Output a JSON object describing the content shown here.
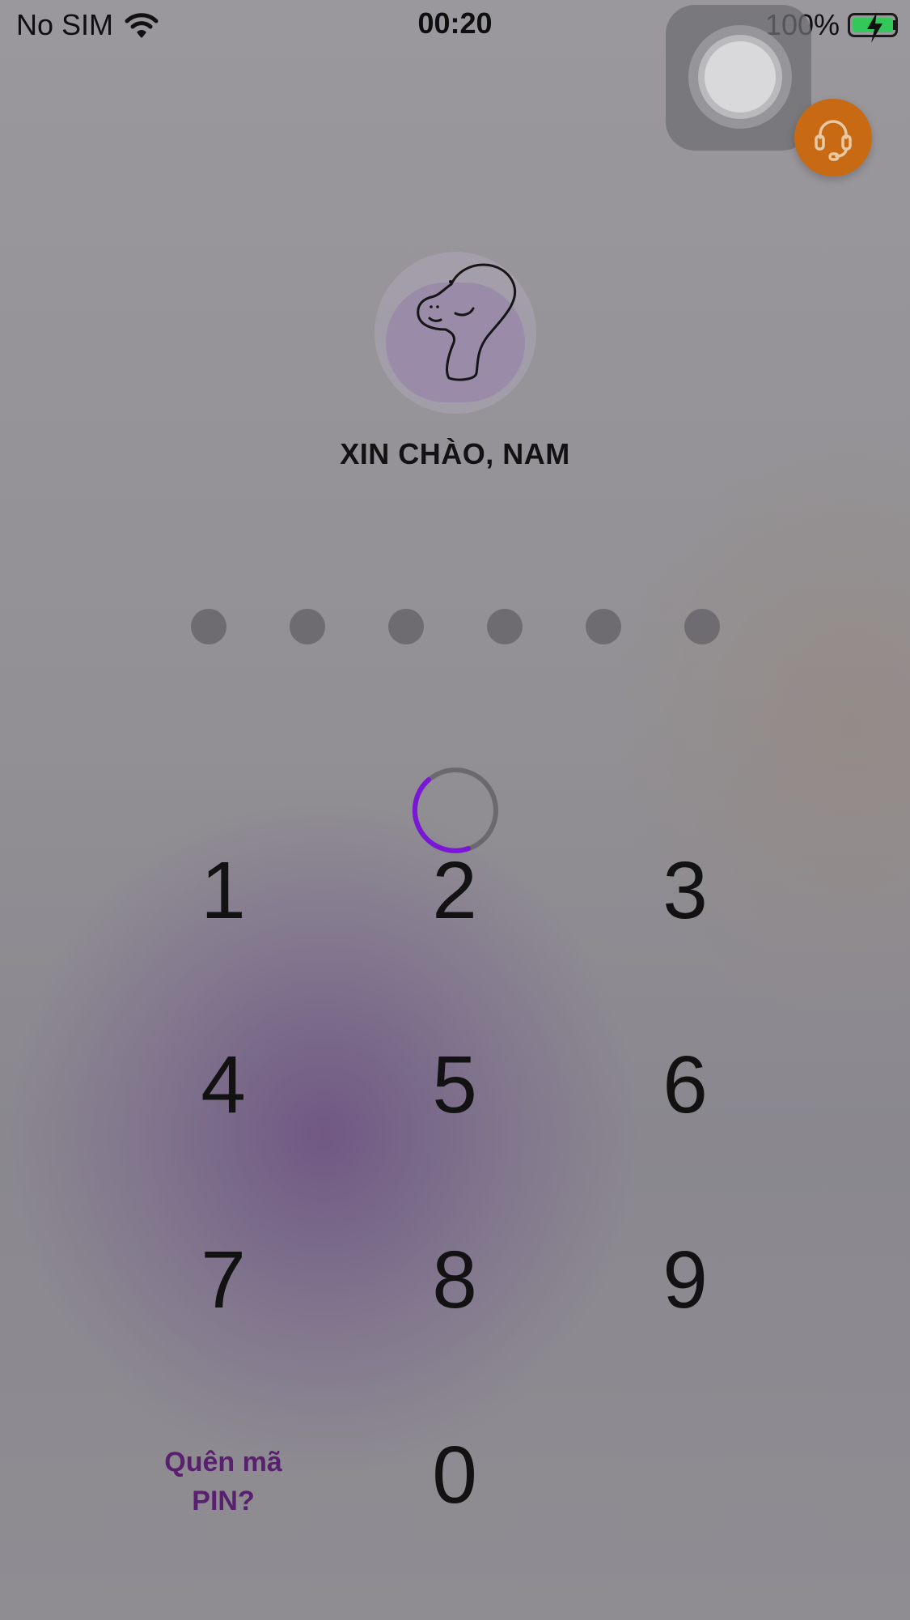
{
  "status_bar": {
    "carrier": "No SIM",
    "time": "00:20",
    "battery": "100%",
    "wifi_icon": "wifi-icon",
    "battery_color": "#34c759"
  },
  "support_button": {
    "icon": "headset-icon",
    "color": "#c86a14"
  },
  "avatar": {
    "icon": "dinosaur-icon"
  },
  "greeting": "XIN CHÀO, NAM",
  "pin": {
    "length": 6,
    "entered": 0
  },
  "spinner": {
    "color": "#7a16d6"
  },
  "keypad": {
    "k1": "1",
    "k2": "2",
    "k3": "3",
    "k4": "4",
    "k5": "5",
    "k6": "6",
    "k7": "7",
    "k8": "8",
    "k9": "9",
    "k0": "0"
  },
  "forgot_pin": {
    "line1": "Quên mã",
    "line2": "PIN?"
  }
}
